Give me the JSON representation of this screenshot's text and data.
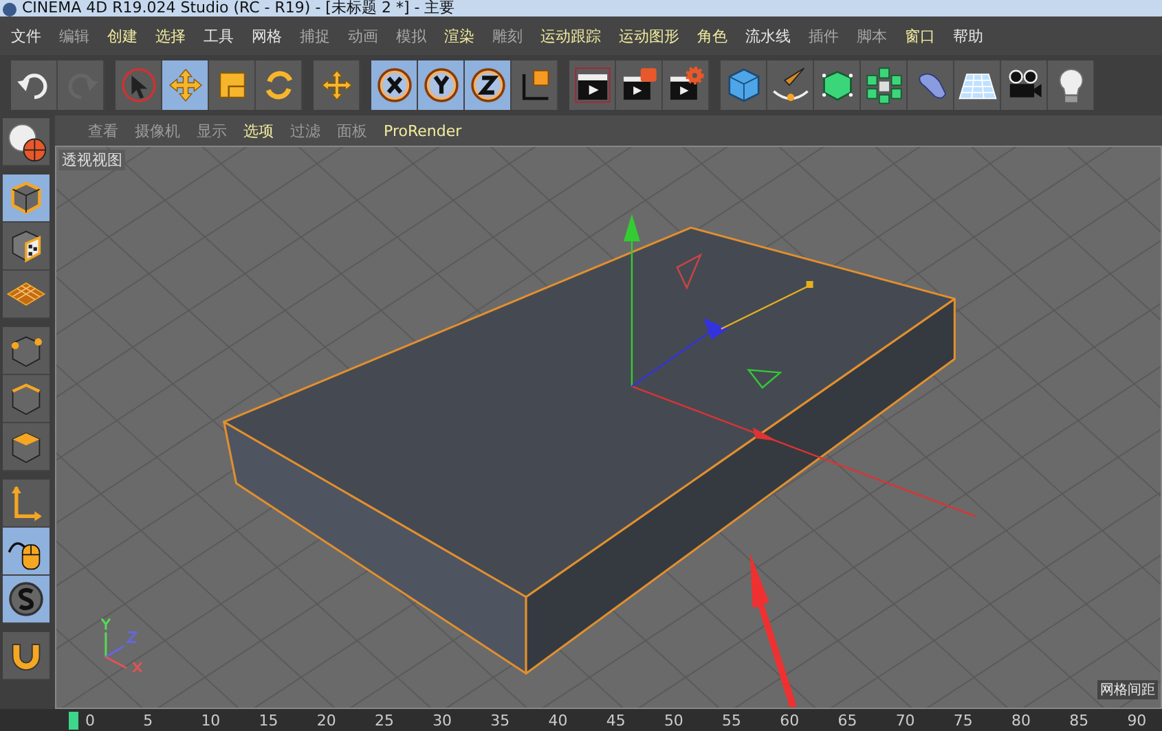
{
  "window": {
    "title": "CINEMA 4D R19.024 Studio (RC - R19) - [未标题 2 *] - 主要"
  },
  "menu": [
    {
      "label": "文件",
      "color": "#e6e6e6"
    },
    {
      "label": "编辑",
      "color": "#a8a8a8"
    },
    {
      "label": "创建",
      "color": "#f2eca0"
    },
    {
      "label": "选择",
      "color": "#f2eca0"
    },
    {
      "label": "工具",
      "color": "#e6e6e6"
    },
    {
      "label": "网格",
      "color": "#e6e6e6"
    },
    {
      "label": "捕捉",
      "color": "#a8a8a8"
    },
    {
      "label": "动画",
      "color": "#a8a8a8"
    },
    {
      "label": "模拟",
      "color": "#a8a8a8"
    },
    {
      "label": "渲染",
      "color": "#f2eca0"
    },
    {
      "label": "雕刻",
      "color": "#a8a8a8"
    },
    {
      "label": "运动跟踪",
      "color": "#f2eca0"
    },
    {
      "label": "运动图形",
      "color": "#f2eca0"
    },
    {
      "label": "角色",
      "color": "#f2eca0"
    },
    {
      "label": "流水线",
      "color": "#e6e6e6"
    },
    {
      "label": "插件",
      "color": "#a8a8a8"
    },
    {
      "label": "脚本",
      "color": "#a8a8a8"
    },
    {
      "label": "窗口",
      "color": "#f2eca0"
    },
    {
      "label": "帮助",
      "color": "#e6e6e6"
    }
  ],
  "toolbar": [
    [
      {
        "kind": "undo",
        "selected": false
      },
      {
        "kind": "redo",
        "selected": false
      }
    ],
    [
      {
        "kind": "select",
        "selected": false
      },
      {
        "kind": "move",
        "selected": true
      },
      {
        "kind": "scale",
        "selected": false
      },
      {
        "kind": "rotate",
        "selected": false
      }
    ],
    [
      {
        "kind": "moveadd",
        "selected": false
      }
    ],
    [
      {
        "kind": "axisx",
        "selected": true
      },
      {
        "kind": "axisy",
        "selected": true
      },
      {
        "kind": "axisz",
        "selected": true
      },
      {
        "kind": "coords",
        "selected": false
      }
    ],
    [
      {
        "kind": "renderview",
        "selected": false
      },
      {
        "kind": "renderpicture",
        "selected": false
      },
      {
        "kind": "rendersettings",
        "selected": false
      }
    ],
    [
      {
        "kind": "cube",
        "selected": false
      },
      {
        "kind": "pen",
        "selected": false
      },
      {
        "kind": "greencube",
        "selected": false
      },
      {
        "kind": "cloner",
        "selected": false
      },
      {
        "kind": "deformer",
        "selected": false
      },
      {
        "kind": "floor",
        "selected": false
      },
      {
        "kind": "camera",
        "selected": false
      },
      {
        "kind": "light",
        "selected": false
      }
    ]
  ],
  "sidebar": [
    [
      {
        "kind": "viewsphere",
        "selected": false
      }
    ],
    [
      {
        "kind": "model",
        "selected": true
      },
      {
        "kind": "texture",
        "selected": false
      },
      {
        "kind": "workplane",
        "selected": false
      }
    ],
    [
      {
        "kind": "points",
        "selected": false
      },
      {
        "kind": "edges",
        "selected": false
      },
      {
        "kind": "polygons",
        "selected": false
      }
    ],
    [
      {
        "kind": "axis",
        "selected": false
      },
      {
        "kind": "tweak",
        "selected": true
      },
      {
        "kind": "snap",
        "selected": true
      }
    ],
    [
      {
        "kind": "magnet",
        "selected": false
      }
    ]
  ],
  "viewport_menu": [
    {
      "label": "查看",
      "color": "#9a9a9a"
    },
    {
      "label": "摄像机",
      "color": "#9a9a9a"
    },
    {
      "label": "显示",
      "color": "#9a9a9a"
    },
    {
      "label": "选项",
      "color": "#f2eca0"
    },
    {
      "label": "过滤",
      "color": "#9a9a9a"
    },
    {
      "label": "面板",
      "color": "#9a9a9a"
    },
    {
      "label": "ProRender",
      "color": "#f2eca0"
    }
  ],
  "viewport": {
    "label": "透视视图",
    "status": "网格间距"
  },
  "timeline": {
    "ticks": [
      "0",
      "5",
      "10",
      "15",
      "20",
      "25",
      "30",
      "35",
      "40",
      "45",
      "50",
      "55",
      "60",
      "65",
      "70",
      "75",
      "80",
      "85",
      "90"
    ]
  }
}
